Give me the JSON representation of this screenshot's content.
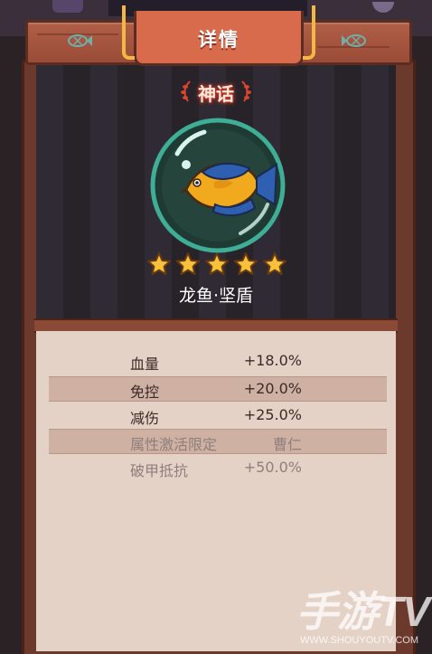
{
  "header": {
    "title": "详情",
    "left_icon": "fish-emblem-icon",
    "right_icon": "fish-emblem-icon"
  },
  "fish": {
    "rarity": "神话",
    "name": "龙鱼·坚盾",
    "stars": 5,
    "star_max": 5,
    "icon": "arowana-fish-icon"
  },
  "stats": [
    {
      "label": "血量",
      "value": "+18.0%",
      "muted": false
    },
    {
      "label": "免控",
      "value": "+20.0%",
      "muted": false
    },
    {
      "label": "减伤",
      "value": "+25.0%",
      "muted": false
    },
    {
      "label": "属性激活限定",
      "value": "曹仁",
      "muted": true
    },
    {
      "label": "破甲抵抗",
      "value": "+50.0%",
      "muted": true
    }
  ],
  "watermark": {
    "brand": "手游TV",
    "url": "WWW.SHOUYOUTV.COM"
  },
  "colors": {
    "wood": "#9a4c38",
    "title_tab": "#d86b4c",
    "gold": "#f2b843",
    "panel_dark": "#2f2a33",
    "stats_bg": "#e5d2c7",
    "rarity_glow": "#e0402a"
  }
}
